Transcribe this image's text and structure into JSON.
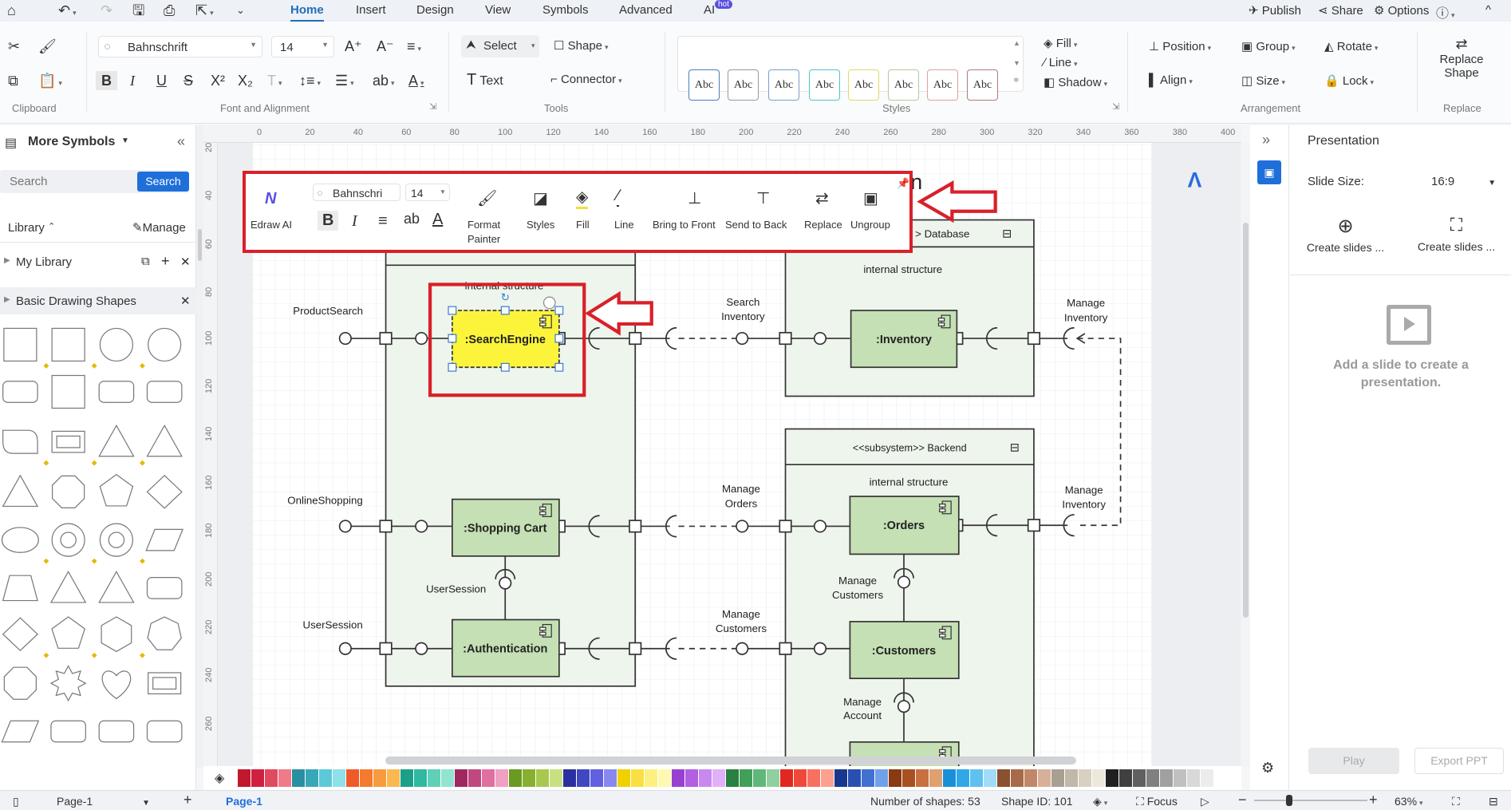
{
  "quick_access": {
    "home": "home-icon",
    "undo": "undo-icon",
    "redo": "redo-icon",
    "save": "save-icon",
    "print": "print-icon",
    "export": "export-icon",
    "more": "more-icon"
  },
  "menu_tabs": [
    {
      "label": "Home",
      "active": true
    },
    {
      "label": "Insert"
    },
    {
      "label": "Design"
    },
    {
      "label": "View"
    },
    {
      "label": "Symbols"
    },
    {
      "label": "Advanced"
    },
    {
      "label": "AI",
      "badge": "hot"
    }
  ],
  "top_right": {
    "publish": "Publish",
    "share": "Share",
    "options": "Options"
  },
  "ribbon": {
    "font_name": "Bahnschrift",
    "font_size": "14",
    "select": "Select",
    "shape": "Shape",
    "text": "Text",
    "connector": "Connector",
    "style_samples": [
      "Abc",
      "Abc",
      "Abc",
      "Abc",
      "Abc",
      "Abc",
      "Abc",
      "Abc"
    ],
    "style_colors": [
      "#4a7fb8",
      "#999999",
      "#7aa0c4",
      "#4fc3c8",
      "#e3d96a",
      "#b5c9a0",
      "#d9a49b",
      "#b07a7a"
    ],
    "fill": "Fill",
    "line": "Line",
    "shadow": "Shadow",
    "position": "Position",
    "group": "Group",
    "rotate": "Rotate",
    "align": "Align",
    "size": "Size",
    "lock": "Lock",
    "replace_shape_1": "Replace",
    "replace_shape_2": "Shape",
    "groups": {
      "clipboard": "Clipboard",
      "font": "Font and Alignment",
      "tools": "Tools",
      "styles": "Styles",
      "arrangement": "Arrangement",
      "replace": "Replace"
    }
  },
  "left_panel": {
    "title": "More Symbols",
    "search_placeholder": "Search",
    "search_button": "Search",
    "library": "Library",
    "manage": "Manage",
    "my_library": "My Library",
    "basic_shapes": "Basic Drawing Shapes"
  },
  "ruler": {
    "top": [
      "0",
      "20",
      "40",
      "60",
      "80",
      "100",
      "120",
      "140",
      "160",
      "180",
      "200",
      "220",
      "240",
      "260",
      "280",
      "300",
      "320",
      "340",
      "360",
      "380",
      "400"
    ],
    "left": [
      "20",
      "40",
      "60",
      "80",
      "100",
      "120",
      "140",
      "160",
      "180",
      "200",
      "220",
      "240",
      "260"
    ]
  },
  "floating_toolbar": {
    "edraw_ai": "Edraw AI",
    "font": "Bahnschri",
    "size": "14",
    "format_painter_1": "Format",
    "format_painter_2": "Painter",
    "styles": "Styles",
    "fill": "Fill",
    "line": "Line",
    "bring_to_front": "Bring to Front",
    "send_to_back": "Send to Back",
    "replace": "Replace",
    "ungroup": "Ungroup"
  },
  "diagram": {
    "title_fragment": "n",
    "database_header": "> Database",
    "backend_header": "<<subsystem>> Backend",
    "internal_structure": "internal structure",
    "components": {
      "search": ":SearchEngine",
      "cart": ":Shopping Cart",
      "auth": ":Authentication",
      "inventory": ":Inventory",
      "orders": ":Orders",
      "customers": ":Customers"
    },
    "labels": {
      "product_search": "ProductSearch",
      "online_shopping": "OnlineShopping",
      "user_session_ext": "UserSession",
      "user_session_int": "UserSession",
      "search_inv_1": "Search",
      "search_inv_2": "Inventory",
      "manage_orders_1": "Manage",
      "manage_orders_2": "Orders",
      "manage_cust_1": "Manage",
      "manage_cust_2": "Customers",
      "manage_inv_a1": "Manage",
      "manage_inv_a2": "Inventory",
      "manage_inv_b1": "Manage",
      "manage_inv_b2": "Inventory",
      "manage_cust_int_1": "Manage",
      "manage_cust_int_2": "Customers",
      "manage_acct_1": "Manage",
      "manage_acct_2": "Account"
    },
    "selected_fill": "#fbf43a",
    "component_fill": "#c5e0b4",
    "subsystem_fill": "#eef5ec",
    "highlight": "#d9202a"
  },
  "right_panel": {
    "title": "Presentation",
    "slide_size_label": "Slide Size:",
    "slide_size": "16:9",
    "create_1": "Create slides ...",
    "create_2": "Create slides ...",
    "empty_1": "Add a slide to create a",
    "empty_2": "presentation.",
    "play": "Play",
    "export": "Export PPT"
  },
  "palette": [
    "#c0182c",
    "#d02040",
    "#e04a60",
    "#f07a8a",
    "#2a8fa0",
    "#38a8b8",
    "#5cc8d8",
    "#8ee0ea",
    "#f05a28",
    "#f47a30",
    "#f89a40",
    "#fbb850",
    "#1aa088",
    "#30b8a0",
    "#60d0b8",
    "#90e4d0",
    "#a02860",
    "#c04880",
    "#e070a0",
    "#f0a0c0",
    "#6a9a20",
    "#88b030",
    "#a8c850",
    "#c8e080",
    "#2a30a0",
    "#4048c0",
    "#6060e0",
    "#8888f0",
    "#f0d000",
    "#f8e040",
    "#fcf080",
    "#fff8b0",
    "#9a40d0",
    "#b060e0",
    "#c888f0",
    "#e0b0f8",
    "#2a8040",
    "#40a058",
    "#60b878",
    "#90d0a0",
    "#e02820",
    "#f04838",
    "#f87060",
    "#fca090",
    "#183890",
    "#2850b0",
    "#4070d0",
    "#70a0e8",
    "#8a3a10",
    "#a85020",
    "#c87040",
    "#e0a070",
    "#1890d8",
    "#30a8e8",
    "#60c0f0",
    "#a0dcf8",
    "#8a5030",
    "#a86a48",
    "#c08868",
    "#d8b098",
    "#a8a090",
    "#c0b8a8",
    "#d8d0c0",
    "#ece8dc",
    "#202020",
    "#404040",
    "#606060",
    "#808080",
    "#a0a0a0",
    "#c0c0c0",
    "#d8d8d8",
    "#ececec"
  ],
  "status": {
    "page_select": "Page-1",
    "active_page": "Page-1",
    "shapes": "Number of shapes: 53",
    "shape_id": "Shape ID: 101",
    "focus": "Focus",
    "zoom": "63%",
    "zoom_level": 63
  }
}
